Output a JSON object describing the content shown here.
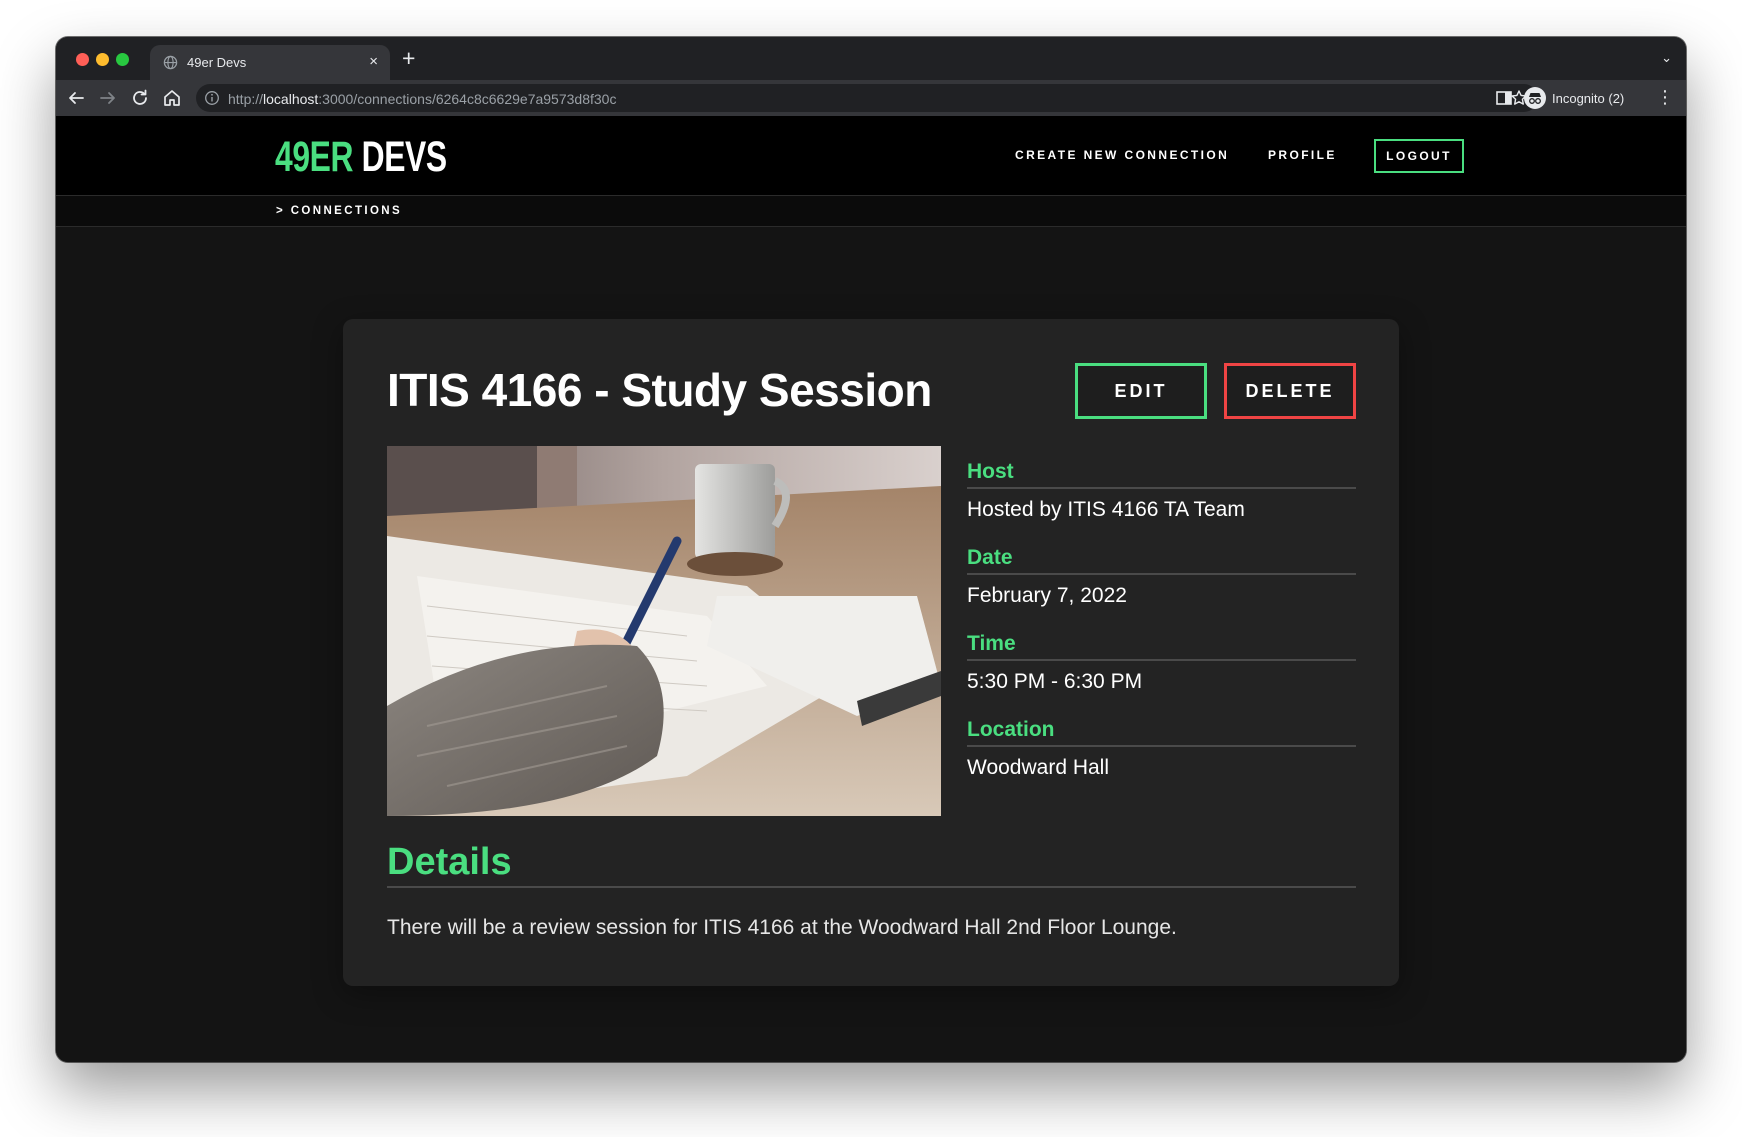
{
  "browser": {
    "tab_title": "49er Devs",
    "tab_close": "×",
    "new_tab": "+",
    "tab_menu": "⌄",
    "url_scheme": "http://",
    "url_host": "localhost",
    "url_path": ":3000/connections/6264c8c6629e7a9573d8f30c",
    "profile_label": "Incognito (2)",
    "menu": "⋮"
  },
  "nav": {
    "brand_accent": "49ER",
    "brand_main": " DEVS",
    "create_connection": "CREATE NEW CONNECTION",
    "profile": "PROFILE",
    "logout": "LOGOUT"
  },
  "breadcrumb": "> CONNECTIONS",
  "connection": {
    "title": "ITIS 4166 - Study Session",
    "edit_label": "EDIT",
    "delete_label": "DELETE",
    "host_label": "Host",
    "host_value": "Hosted by ITIS 4166 TA Team",
    "date_label": "Date",
    "date_value": "February 7, 2022",
    "time_label": "Time",
    "time_value": "5:30 PM - 6:30 PM",
    "location_label": "Location",
    "location_value": "Woodward Hall",
    "details_heading": "Details",
    "details_text": "There will be a review session for ITIS 4166 at the Woodward Hall 2nd Floor Lounge."
  },
  "colors": {
    "accent_green": "#4ade80",
    "danger_red": "#ef4444",
    "page_bg": "#141414",
    "card_bg": "#232323"
  }
}
